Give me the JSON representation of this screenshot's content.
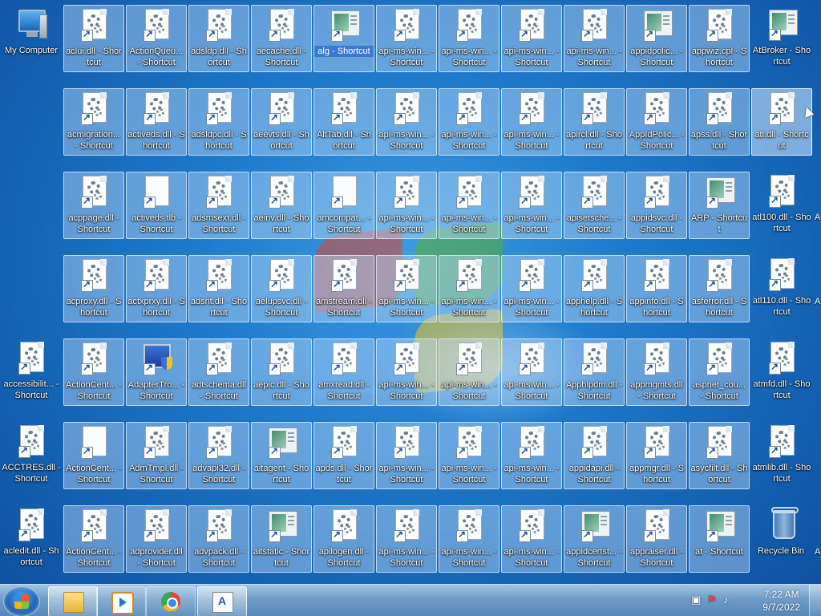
{
  "desktop": {
    "system_icons": [
      {
        "label": "My Computer",
        "glyph": "computer"
      },
      {
        "label": "Recycle Bin",
        "glyph": "bin"
      }
    ],
    "columns": [
      [
        {
          "label": "acledit.dll - Shortcut",
          "g": "gear"
        }
      ],
      [
        {
          "label": "accessibilit... - Shortcut",
          "g": "gear"
        },
        {
          "label": "ACCTRES.dll - Shortcut",
          "g": "gear"
        }
      ],
      [
        {
          "label": "aclui.dll - Shortcut",
          "g": "gear"
        },
        {
          "label": "acmigration... - Shortcut",
          "g": "gear"
        },
        {
          "label": "acppage.dll - Shortcut",
          "g": "gear"
        },
        {
          "label": "acproxy.dll - Shortcut",
          "g": "gear"
        },
        {
          "label": "ActionCent... - Shortcut",
          "g": "gear"
        },
        {
          "label": "ActionCent... - Shortcut",
          "g": "plain"
        },
        {
          "label": "ActionCent... - Shortcut",
          "g": "gear"
        }
      ],
      [
        {
          "label": "ActionQueu... - Shortcut",
          "g": "gear"
        },
        {
          "label": "activeds.dll - Shortcut",
          "g": "gear"
        },
        {
          "label": "activeds.tlb - Shortcut",
          "g": "plain"
        },
        {
          "label": "actxprxy.dll - Shortcut",
          "g": "gear"
        },
        {
          "label": "AdapterTro... - Shortcut",
          "g": "shield"
        },
        {
          "label": "AdmTmpl.dll - Shortcut",
          "g": "gear"
        },
        {
          "label": "adprovider.dll - Shortcut",
          "g": "gear"
        }
      ],
      [
        {
          "label": "adsldp.dll - Shortcut",
          "g": "gear"
        },
        {
          "label": "adsldpc.dll - Shortcut",
          "g": "gear"
        },
        {
          "label": "adsmsext.dll - Shortcut",
          "g": "gear"
        },
        {
          "label": "adsnt.dll - Shortcut",
          "g": "gear"
        },
        {
          "label": "adtschema.dll - Shortcut",
          "g": "gear"
        },
        {
          "label": "advapi32.dll - Shortcut",
          "g": "gear"
        },
        {
          "label": "advpack.dll - Shortcut",
          "g": "gear"
        }
      ],
      [
        {
          "label": "aecache.dll - Shortcut",
          "g": "gear"
        },
        {
          "label": "aeevts.dll - Shortcut",
          "g": "gear"
        },
        {
          "label": "aeinv.dll - Shortcut",
          "g": "gear"
        },
        {
          "label": "aelupsvc.dll - Shortcut",
          "g": "gear"
        },
        {
          "label": "aepic.dll - Shortcut",
          "g": "gear"
        },
        {
          "label": "aitagent - Shortcut",
          "g": "win"
        },
        {
          "label": "aitstatic - Shortcut",
          "g": "win"
        }
      ],
      [
        {
          "label": "alg - Shortcut",
          "g": "win"
        },
        {
          "label": "AltTab.dll - Shortcut",
          "g": "gear"
        },
        {
          "label": "amcompat... - Shortcut",
          "g": "plain"
        },
        {
          "label": "amstream.dll - Shortcut",
          "g": "gear"
        },
        {
          "label": "amxread.dll - Shortcut",
          "g": "gear"
        },
        {
          "label": "apds.dll - Shortcut",
          "g": "gear"
        },
        {
          "label": "apilogen.dll - Shortcut",
          "g": "gear"
        }
      ],
      [
        {
          "label": "api-ms-win... - Shortcut",
          "g": "gear"
        },
        {
          "label": "api-ms-win... - Shortcut",
          "g": "gear"
        },
        {
          "label": "api-ms-win... - Shortcut",
          "g": "gear"
        },
        {
          "label": "api-ms-win... - Shortcut",
          "g": "gear"
        },
        {
          "label": "api-ms-win... - Shortcut",
          "g": "gear"
        },
        {
          "label": "api-ms-win... - Shortcut",
          "g": "gear"
        },
        {
          "label": "api-ms-win... - Shortcut",
          "g": "gear"
        }
      ],
      [
        {
          "label": "api-ms-win... - Shortcut",
          "g": "gear"
        },
        {
          "label": "api-ms-win... - Shortcut",
          "g": "gear"
        },
        {
          "label": "api-ms-win... - Shortcut",
          "g": "gear"
        },
        {
          "label": "api-ms-win... - Shortcut",
          "g": "gear"
        },
        {
          "label": "api-ms-win... - Shortcut",
          "g": "gear"
        },
        {
          "label": "api-ms-win... - Shortcut",
          "g": "gear"
        },
        {
          "label": "api-ms-win... - Shortcut",
          "g": "gear"
        }
      ],
      [
        {
          "label": "api-ms-win... - Shortcut",
          "g": "gear"
        },
        {
          "label": "api-ms-win... - Shortcut",
          "g": "gear"
        },
        {
          "label": "api-ms-win... - Shortcut",
          "g": "gear"
        },
        {
          "label": "api-ms-win... - Shortcut",
          "g": "gear"
        },
        {
          "label": "api-ms-win... - Shortcut",
          "g": "gear"
        },
        {
          "label": "api-ms-win... - Shortcut",
          "g": "gear"
        },
        {
          "label": "api-ms-win... - Shortcut",
          "g": "gear"
        }
      ],
      [
        {
          "label": "api-ms-win... - Shortcut",
          "g": "gear"
        },
        {
          "label": "apircl.dll - Shortcut",
          "g": "gear"
        },
        {
          "label": "apisetsche... - Shortcut",
          "g": "gear"
        },
        {
          "label": "apphelp.dll - Shortcut",
          "g": "gear"
        },
        {
          "label": "Apphlpdm.dll - Shortcut",
          "g": "gear"
        },
        {
          "label": "appidapi.dll - Shortcut",
          "g": "gear"
        },
        {
          "label": "appidcertst... - Shortcut",
          "g": "win"
        }
      ],
      [
        {
          "label": "appidpolic... - Shortcut",
          "g": "win"
        },
        {
          "label": "AppIdPolic... - Shortcut",
          "g": "gear"
        },
        {
          "label": "appidsvc.dll - Shortcut",
          "g": "gear"
        },
        {
          "label": "appinfo.dll - Shortcut",
          "g": "gear"
        },
        {
          "label": "appmgmts.dll - Shortcut",
          "g": "gear"
        },
        {
          "label": "appmgr.dll - Shortcut",
          "g": "gear"
        },
        {
          "label": "appraiser.dll - Shortcut",
          "g": "gear"
        }
      ],
      [
        {
          "label": "appwiz.cpl - Shortcut",
          "g": "gear"
        },
        {
          "label": "apss.dll - Shortcut",
          "g": "gear"
        },
        {
          "label": "ARP - Shortcut",
          "g": "win"
        },
        {
          "label": "asferror.dll - Shortcut",
          "g": "gear"
        },
        {
          "label": "aspnet_cou... - Shortcut",
          "g": "gear"
        },
        {
          "label": "asycfilt.dll - Shortcut",
          "g": "gear"
        },
        {
          "label": "at - Shortcut",
          "g": "win"
        }
      ],
      [
        {
          "label": "AtBroker - Shortcut",
          "g": "win"
        },
        {
          "label": "atl.dll - Shortcut",
          "g": "gear"
        },
        {
          "label": "atl100.dll - Shortcut",
          "g": "gear"
        },
        {
          "label": "atl110.dll - Shortcut",
          "g": "gear"
        },
        {
          "label": "atmfd.dll - Shortcut",
          "g": "gear"
        },
        {
          "label": "atmlib.dll - Shortcut",
          "g": "gear"
        }
      ]
    ],
    "partial_letters": [
      "A",
      "A",
      "A"
    ]
  },
  "taskbar": {
    "buttons": [
      "Windows Explorer",
      "Windows Media Center",
      "Google Chrome",
      "WordPad"
    ],
    "clock_time": "7:22 AM",
    "clock_date": "9/7/2022"
  }
}
